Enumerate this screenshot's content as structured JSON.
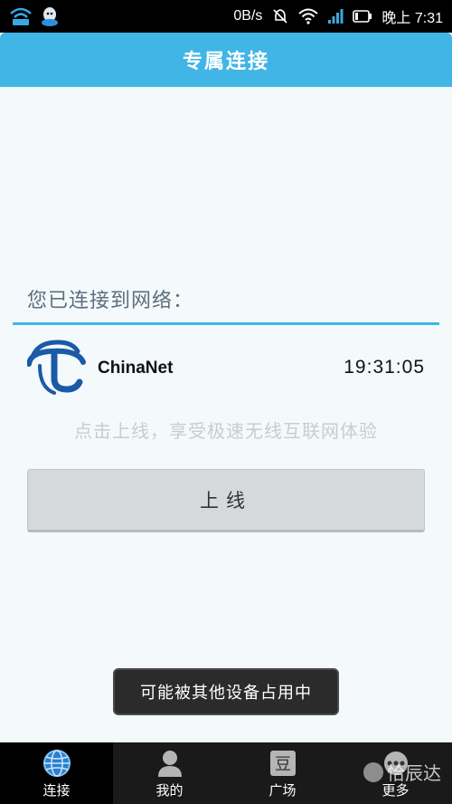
{
  "status_bar": {
    "net_speed": "0B/s",
    "time": "晚上 7:31"
  },
  "title_bar": {
    "title": "专属连接"
  },
  "connection": {
    "label": "您已连接到网络：",
    "network_name": "ChinaNet",
    "duration": "19:31:05",
    "hint": "点击上线，享受极速无线互联网体验",
    "online_button": "上线"
  },
  "toast": {
    "message": "可能被其他设备占用中"
  },
  "bottom_nav": {
    "items": [
      {
        "label": "连接",
        "icon": "globe-icon",
        "active": true
      },
      {
        "label": "我的",
        "icon": "person-icon",
        "active": false
      },
      {
        "label": "广场",
        "icon": "bean-box-icon",
        "icon_text": "豆",
        "active": false
      },
      {
        "label": "更多",
        "icon": "more-icon",
        "active": false
      }
    ]
  },
  "watermark": {
    "text": "恰辰达"
  },
  "colors": {
    "accent": "#41b5e6",
    "background": "#f4f9fc",
    "button": "#d6d9dc",
    "nav_bg": "#1a1a1a"
  }
}
